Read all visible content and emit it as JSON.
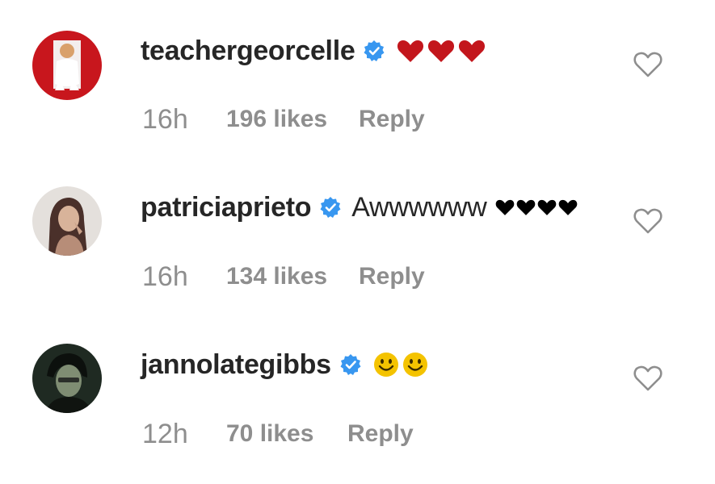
{
  "comments": [
    {
      "username": "teachergeorcelle",
      "verified": true,
      "text": "",
      "emoji": [
        "red-heart",
        "red-heart",
        "red-heart"
      ],
      "time": "16h",
      "likes": "196 likes",
      "reply_label": "Reply"
    },
    {
      "username": "patriciaprieto",
      "verified": true,
      "text": "Awwwwww",
      "emoji": [
        "black-heart",
        "black-heart",
        "black-heart",
        "black-heart"
      ],
      "time": "16h",
      "likes": "134 likes",
      "reply_label": "Reply"
    },
    {
      "username": "jannolategibbs",
      "verified": true,
      "text": "",
      "emoji": [
        "smiling-face",
        "smiling-face"
      ],
      "time": "12h",
      "likes": "70 likes",
      "reply_label": "Reply"
    }
  ],
  "colors": {
    "username": "#262626",
    "meta": "#8e8e8e",
    "verified_badge": "#3897f0",
    "red_heart": "#c3161c",
    "black_heart": "#000000",
    "smile_face": "#f4c300",
    "like_icon_stroke": "#8e8e8e"
  }
}
